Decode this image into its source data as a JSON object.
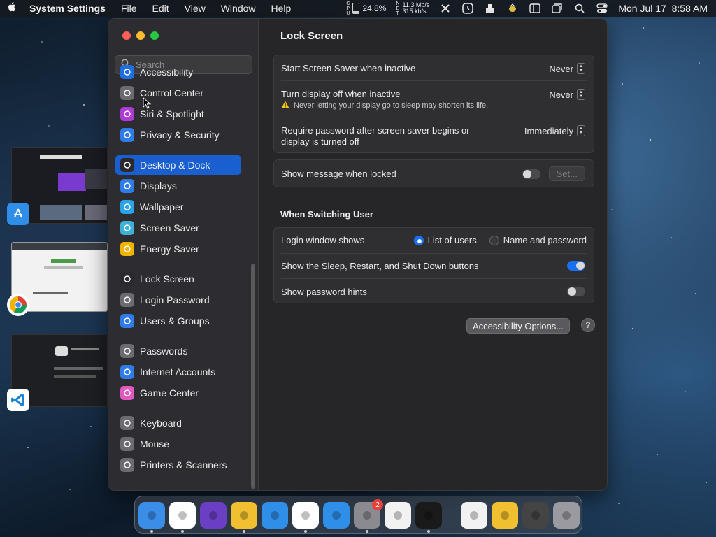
{
  "menubar": {
    "app_name": "System Settings",
    "menus": [
      "File",
      "Edit",
      "View",
      "Window",
      "Help"
    ],
    "cpu_label_top": "C",
    "cpu_label_mid": "P",
    "cpu_label_bot": "U",
    "cpu_percent": "24.8%",
    "cpu_fraction": 0.248,
    "net_up": "11.3 Mb/s",
    "net_down": "315 kb/s",
    "net_label_top": "N",
    "net_label_mid": "E",
    "net_label_bot": "T",
    "datetime": "Mon Jul 17  8:58 AM"
  },
  "sidebar": {
    "search_placeholder": "Search",
    "items": [
      {
        "label": "Accessibility",
        "icon": "accessibility-icon",
        "color": "#1f6fe0"
      },
      {
        "label": "Control Center",
        "icon": "control-center-icon",
        "color": "#6b6b70"
      },
      {
        "label": "Siri & Spotlight",
        "icon": "siri-icon",
        "color": "#b03ad6"
      },
      {
        "label": "Privacy & Security",
        "icon": "hand-icon",
        "color": "#2f7be8"
      },
      {
        "label": "Desktop & Dock",
        "icon": "dock-icon",
        "color": "#2a2a2e"
      },
      {
        "label": "Displays",
        "icon": "sun-icon",
        "color": "#2f7be8"
      },
      {
        "label": "Wallpaper",
        "icon": "flower-icon",
        "color": "#2aa3e8"
      },
      {
        "label": "Screen Saver",
        "icon": "screen-saver-icon",
        "color": "#3fb0d8"
      },
      {
        "label": "Energy Saver",
        "icon": "lightbulb-icon",
        "color": "#f0b400"
      },
      {
        "label": "Lock Screen",
        "icon": "lock-icon",
        "color": "#2a2a2e"
      },
      {
        "label": "Login Password",
        "icon": "login-lock-icon",
        "color": "#6b6b70"
      },
      {
        "label": "Users & Groups",
        "icon": "users-icon",
        "color": "#2f7be8"
      },
      {
        "label": "Passwords",
        "icon": "key-icon",
        "color": "#6b6b70"
      },
      {
        "label": "Internet Accounts",
        "icon": "at-icon",
        "color": "#2f7be8"
      },
      {
        "label": "Game Center",
        "icon": "game-center-icon",
        "color": "#e05ac0"
      },
      {
        "label": "Keyboard",
        "icon": "keyboard-icon",
        "color": "#6b6b70"
      },
      {
        "label": "Mouse",
        "icon": "mouse-icon",
        "color": "#6b6b70"
      },
      {
        "label": "Printers & Scanners",
        "icon": "printer-icon",
        "color": "#6b6b70"
      }
    ],
    "selected": "Desktop & Dock"
  },
  "main": {
    "title": "Lock Screen",
    "screen_saver_label": "Start Screen Saver when inactive",
    "screen_saver_value": "Never",
    "display_off_label": "Turn display off when inactive",
    "display_off_value": "Never",
    "display_off_warning": "Never letting your display go to sleep may shorten its life.",
    "require_password_label_1": "Require password after screen saver begins or",
    "require_password_label_2": "display is turned off",
    "require_password_value": "Immediately",
    "show_message_label": "Show message when locked",
    "show_message_on": false,
    "set_button": "Set...",
    "switching_title": "When Switching User",
    "login_window_label": "Login window shows",
    "login_option_1": "List of users",
    "login_option_2": "Name and password",
    "login_selected": "List of users",
    "sleep_restart_label": "Show the Sleep, Restart, and Shut Down buttons",
    "sleep_restart_on": true,
    "password_hints_label": "Show password hints",
    "password_hints_on": false,
    "accessibility_options_button": "Accessibility Options...",
    "help_button": "?"
  },
  "dock": {
    "items": [
      {
        "name": "finder",
        "icon": "finder-icon",
        "color": "#3a8ee8"
      },
      {
        "name": "vscode",
        "icon": "vscode-icon",
        "color": "#ffffff"
      },
      {
        "name": "visual-studio",
        "icon": "visual-studio-icon",
        "color": "#6b3fc4"
      },
      {
        "name": "cyberduck",
        "icon": "bee-icon",
        "color": "#f0c030"
      },
      {
        "name": "safari",
        "icon": "safari-icon",
        "color": "#2f8fe8"
      },
      {
        "name": "chrome",
        "icon": "chrome-icon",
        "color": "#ffffff"
      },
      {
        "name": "app-store",
        "icon": "app-store-icon",
        "color": "#2f8fe8"
      },
      {
        "name": "system-settings",
        "icon": "gear-icon",
        "color": "#8a8a90"
      },
      {
        "name": "textedit",
        "icon": "pen-icon",
        "color": "#f2f2f2"
      },
      {
        "name": "terminal",
        "icon": "terminal-icon",
        "color": "#1a1a1a"
      },
      {
        "name": "document",
        "icon": "document-icon",
        "color": "#f2f2f2"
      },
      {
        "name": "cyberduck-doc",
        "icon": "bee-icon",
        "color": "#f0c030"
      },
      {
        "name": "downloads",
        "icon": "downloads-icon",
        "color": "#444"
      },
      {
        "name": "trash",
        "icon": "trash-icon",
        "color": "#9a9aa0"
      }
    ],
    "system_settings_badge": "2"
  }
}
